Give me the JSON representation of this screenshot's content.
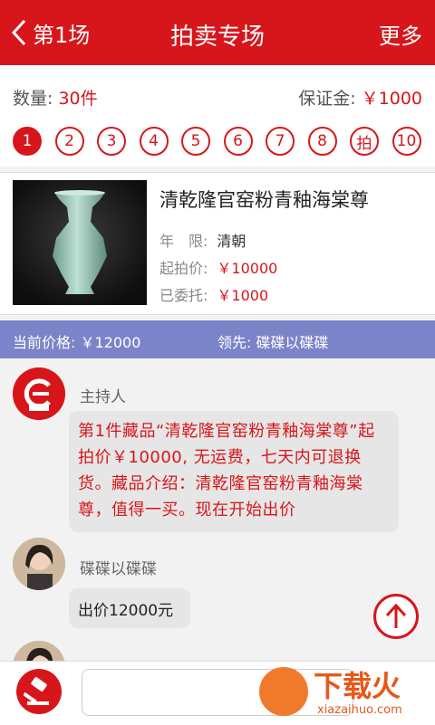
{
  "header": {
    "back_label": "第1场",
    "title": "拍卖专场",
    "more_label": "更多"
  },
  "info": {
    "quantity_label": "数量:",
    "quantity_value": "30件",
    "deposit_label": "保证金:",
    "deposit_value": "￥1000",
    "pages": [
      "1",
      "2",
      "3",
      "4",
      "5",
      "6",
      "7",
      "8",
      "拍",
      "10"
    ],
    "active_page": "1"
  },
  "item": {
    "name": "清乾隆官窑粉青釉海棠尊",
    "era_label": "年　限:",
    "era_value": "清朝",
    "start_label": "起拍价:",
    "start_value": "￥10000",
    "entrust_label": "已委托:",
    "entrust_value": "￥1000"
  },
  "bidbar": {
    "price_text": "当前价格: ￥12000",
    "leader_text": "领先:  碟碟以碟碟"
  },
  "chat": {
    "host_name": "主持人",
    "host_message": "第1件藏品“清乾隆官窑粉青釉海棠尊”起拍价￥10000, 无运费，七天内可退换货。藏品介绍：清乾隆官窑粉青釉海棠尊，值得一买。现在开始出价",
    "user_name": "碟碟以碟碟",
    "user_message": "出价12000元"
  },
  "watermark": {
    "title": "下载火",
    "site": "xiazaihuo.com"
  },
  "colors": {
    "brand_red": "#d7161b",
    "bid_bar": "#7b84c8",
    "watermark": "#e8571a"
  }
}
